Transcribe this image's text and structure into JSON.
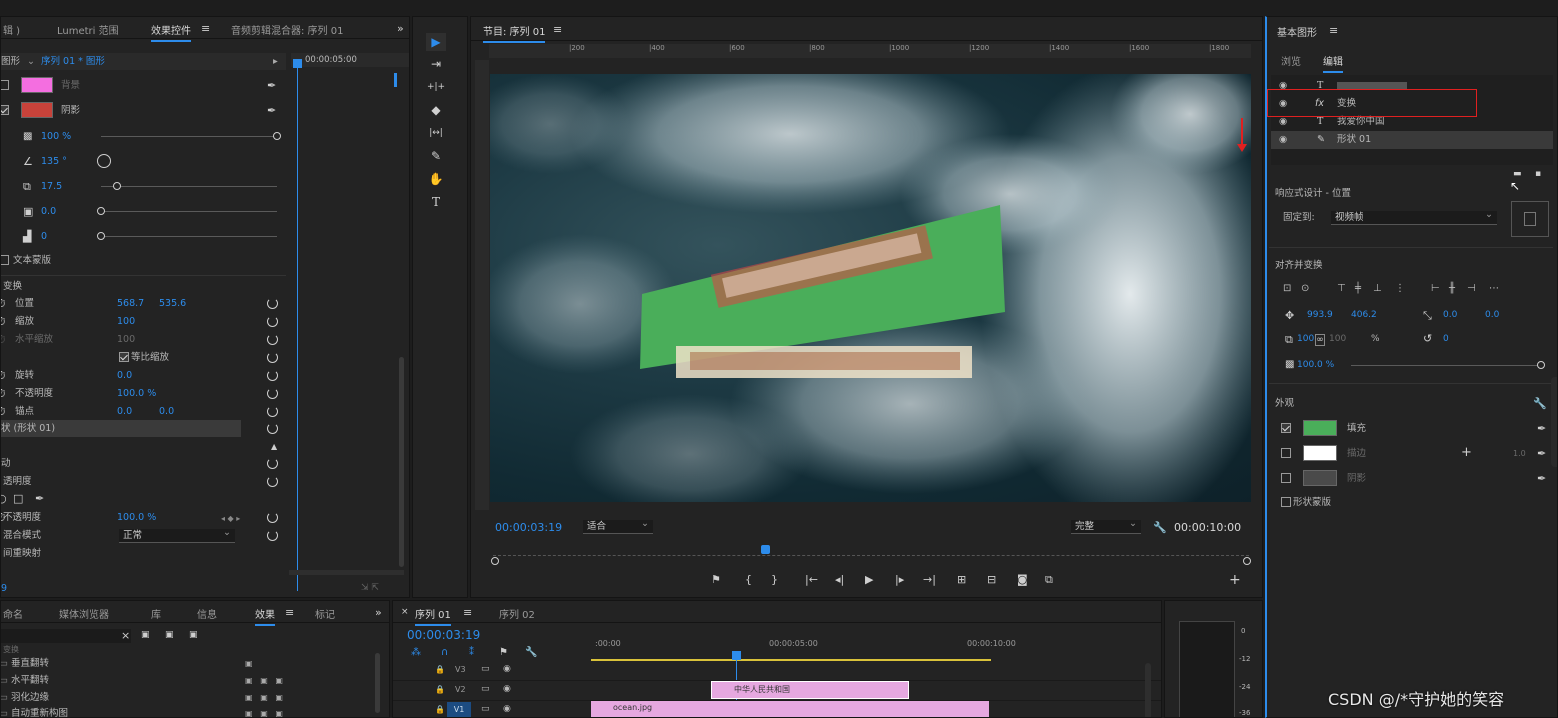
{
  "top_menu": [
    "",
    "",
    "",
    "",
    "",
    "",
    "",
    "",
    "",
    "",
    ""
  ],
  "effect_controls": {
    "tabs": [
      "辑 )",
      "Lumetri 范围",
      "效果控件",
      "音频剪辑混合器: 序列 01"
    ],
    "active_tab": "效果控件",
    "clip_name": "序列 01 * 图形",
    "prefix": "图形",
    "timecode": "00:00:05:00",
    "bg_label": "背景",
    "shadow_label": "阴影",
    "bg_color": "#f46ee0",
    "shadow_color": "#c8423a",
    "opacity_val": "100 %",
    "angle_val": "135 °",
    "distance_val": "17.5",
    "size_val": "0.0",
    "blur_val": "0",
    "text_mask": "文本蒙版",
    "transform_title": "变换",
    "position_label": "位置",
    "position_x": "568.7",
    "position_y": "535.6",
    "scale_label": "缩放",
    "scale_val": "100",
    "scale_w_label": "水平缩放",
    "scale_w_val": "100",
    "uniform_label": "等比缩放",
    "rotation_label": "旋转",
    "rotation_val": "0.0",
    "opacity_label": "不透明度",
    "opacity2_val": "100.0 %",
    "anchor_label": "锚点",
    "anchor_x": "0.0",
    "anchor_y": "0.0",
    "shape_layer": "状 (形状 01)",
    "motion_label": "动",
    "opacity_section": "透明度",
    "opacity3_label": "不透明度",
    "opacity3_val": "100.0 %",
    "blend_label": "混合模式",
    "blend_val": "正常",
    "time_remap": "间重映射",
    "footer_time": "9"
  },
  "tools": [
    "▶",
    "⇥",
    "+|+",
    "◆",
    "|↔|",
    "✎",
    "✋",
    "T"
  ],
  "program_monitor": {
    "title": "节目: 序列 01",
    "ruler_labels": [
      "|200",
      "|400",
      "|600",
      "|800",
      "|1000",
      "|1200",
      "|1400",
      "|1600",
      "|1800"
    ],
    "timecode": "00:00:03:19",
    "fit": "适合",
    "quality": "完整",
    "duration": "00:00:10:00"
  },
  "essential_graphics": {
    "title": "基本图形",
    "tab_browse": "浏览",
    "tab_edit": "编辑",
    "layers": [
      {
        "icon": "T",
        "name": ""
      },
      {
        "icon": "fx",
        "name": "变换"
      },
      {
        "icon": "T",
        "name": "我爱你中国"
      },
      {
        "icon": "✎",
        "name": "形状 01"
      }
    ],
    "responsive": "响应式设计 - 位置",
    "pin_to": "固定到:",
    "pin_val": "视频帧",
    "align": "对齐并变换",
    "pos_x": "993.9",
    "pos_y": "406.2",
    "anchor_x": "0.0",
    "anchor_y": "0.0",
    "scale_1": "100",
    "scale_2": "100",
    "scale_unit": "%",
    "rotation": "0",
    "opacity": "100.0 %",
    "appearance": "外观",
    "fill": "填充",
    "stroke": "描边",
    "stroke_w": "1.0",
    "shadow": "阴影",
    "shape_mask": "形状蒙版",
    "fill_color": "#4aae5a",
    "stroke_color": "#ffffff",
    "shadow_color": "#4a4a4a"
  },
  "project": {
    "tabs": [
      "命名",
      "媒体浏览器",
      "库",
      "信息",
      "效果",
      "标记"
    ],
    "active_tab": "效果",
    "items": [
      "变换",
      "垂直翻转",
      "水平翻转",
      "羽化边缘",
      "自动重新构图"
    ]
  },
  "timeline": {
    "tabs": [
      "序列 01",
      "序列 02"
    ],
    "timecode": "00:00:03:19",
    "ruler": [
      ":00:00",
      "00:00:05:00",
      "00:00:10:00"
    ],
    "tracks": [
      {
        "name": "V3"
      },
      {
        "name": "V2",
        "clip": "中华人民共和国"
      },
      {
        "name": "V1",
        "clip": "ocean.jpg"
      }
    ]
  },
  "meter_labels": [
    "0",
    "-12",
    "-24",
    "-36"
  ],
  "watermark": "CSDN @/*守护她的笑容"
}
